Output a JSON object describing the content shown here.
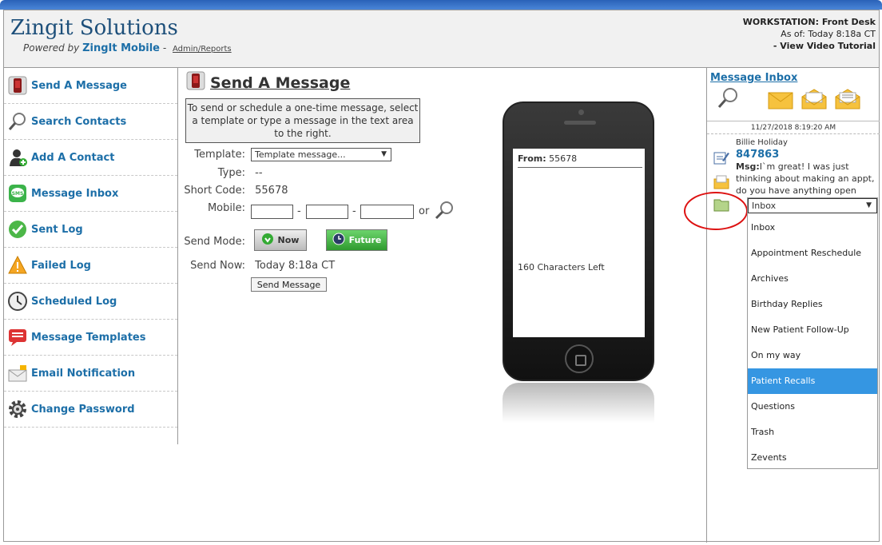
{
  "header": {
    "brand": "Zingit Solutions",
    "powered_prefix": "Powered by",
    "powered_brand": "ZingIt Mobile",
    "powered_sep": "-",
    "admin_link": "Admin/Reports",
    "workstation": "WORKSTATION: Front Desk",
    "as_of": "As of: Today 8:18a  CT",
    "tutorial": "- View Video Tutorial"
  },
  "sidebar": {
    "items": [
      {
        "label": "Send A Message",
        "icon": "phone-icon"
      },
      {
        "label": "Search Contacts",
        "icon": "magnifier-icon"
      },
      {
        "label": "Add A Contact",
        "icon": "add-user-icon"
      },
      {
        "label": "Message Inbox",
        "icon": "sms-icon"
      },
      {
        "label": "Sent Log",
        "icon": "check-icon"
      },
      {
        "label": "Failed Log",
        "icon": "warning-icon"
      },
      {
        "label": "Scheduled Log",
        "icon": "clock-icon"
      },
      {
        "label": "Message Templates",
        "icon": "speech-bubble-icon"
      },
      {
        "label": "Email Notification",
        "icon": "envelope-icon"
      },
      {
        "label": "Change Password",
        "icon": "gear-icon"
      }
    ]
  },
  "main": {
    "title": "Send A Message",
    "instructions": "To send or schedule a one-time message, select a template or type a message in the text area to the right.",
    "template_label": "Template:",
    "template_value": "Template message...",
    "type_label": "Type:",
    "type_value": "--",
    "shortcode_label": "Short Code:",
    "shortcode_value": "55678",
    "mobile_label": "Mobile:",
    "mobile_dash": "-",
    "mobile_or": "or",
    "sendmode_label": "Send Mode:",
    "now_label": "Now",
    "future_label": "Future",
    "sendnow_label": "Send Now:",
    "sendnow_value": "Today 8:18a CT",
    "send_button": "Send Message"
  },
  "phone": {
    "from_label": "From:",
    "from_value": "55678",
    "chars_left": "160 Characters Left"
  },
  "inbox": {
    "title": "Message Inbox",
    "date": "11/27/2018 8:19:20 AM",
    "contact_name": "Billie Holiday",
    "contact_number": "847863",
    "msg_label": "Msg:",
    "msg_text": "I`m great! I was just thinking about making an appt, do you have anything open"
  },
  "folder_dropdown": {
    "selected": "Inbox",
    "options": [
      "Inbox",
      "Appointment Reschedule",
      "Archives",
      "Birthday Replies",
      "New Patient Follow-Up",
      "On my way",
      "Patient Recalls",
      "Questions",
      "Trash",
      "Zevents"
    ],
    "highlighted": "Patient Recalls"
  },
  "colors": {
    "link": "#1d6fa8",
    "highlight": "#3596e2",
    "annotation": "#dd1111"
  }
}
